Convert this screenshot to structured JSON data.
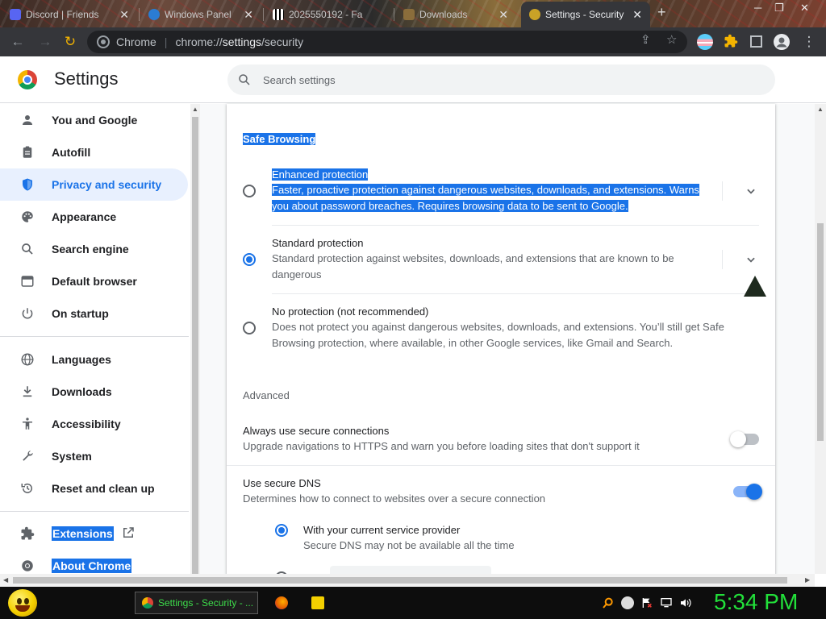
{
  "tabs": [
    {
      "title": "Discord | Friends",
      "close": "✕"
    },
    {
      "title": "Windows Panel",
      "close": "✕"
    },
    {
      "title": "2025550192 - Fa",
      "close": ""
    },
    {
      "title": "Downloads",
      "close": "✕"
    },
    {
      "title": "Settings - Security",
      "close": "✕",
      "active": true
    }
  ],
  "toolbar": {
    "app_label": "Chrome",
    "url_prefix": "chrome://",
    "url_host": "settings",
    "url_path": "/security"
  },
  "header": {
    "title": "Settings",
    "search_placeholder": "Search settings"
  },
  "sidebar": {
    "items": [
      {
        "label": "You and Google",
        "icon": "person-icon"
      },
      {
        "label": "Autofill",
        "icon": "clipboard-icon"
      },
      {
        "label": "Privacy and security",
        "icon": "shield-icon",
        "selected": true
      },
      {
        "label": "Appearance",
        "icon": "palette-icon"
      },
      {
        "label": "Search engine",
        "icon": "search-icon"
      },
      {
        "label": "Default browser",
        "icon": "browser-icon"
      },
      {
        "label": "On startup",
        "icon": "power-icon"
      },
      {
        "label": "Languages",
        "icon": "globe-icon"
      },
      {
        "label": "Downloads",
        "icon": "download-icon"
      },
      {
        "label": "Accessibility",
        "icon": "accessibility-icon"
      },
      {
        "label": "System",
        "icon": "wrench-icon"
      },
      {
        "label": "Reset and clean up",
        "icon": "history-icon"
      },
      {
        "label": "Extensions",
        "icon": "puzzle-icon"
      },
      {
        "label": "About Chrome",
        "icon": "chrome-icon"
      }
    ]
  },
  "safe_browsing": {
    "title": "Safe Browsing",
    "options": [
      {
        "label": "Enhanced protection",
        "desc_line1": "Faster, proactive protection against dangerous websites, downloads, and extensions. Warns",
        "desc_line2": "you about password breaches. Requires browsing data to be sent to Google.",
        "selected": false
      },
      {
        "label": "Standard protection",
        "desc_line1": "Standard protection against websites, downloads, and extensions that are known to be",
        "desc_line2": "dangerous",
        "selected": true
      },
      {
        "label": "No protection (not recommended)",
        "desc_line1": "Does not protect you against dangerous websites, downloads, and extensions. You’ll still get Safe",
        "desc_line2": "Browsing protection, where available, in other Google services, like Gmail and Search.",
        "selected": false
      }
    ]
  },
  "advanced": {
    "title": "Advanced",
    "secure_connections": {
      "label": "Always use secure connections",
      "desc": "Upgrade navigations to HTTPS and warn you before loading sites that don't support it",
      "enabled": false
    },
    "secure_dns": {
      "label": "Use secure DNS",
      "desc": "Determines how to connect to websites over a secure connection",
      "enabled": true,
      "provider_label": "With your current service provider",
      "provider_desc": "Secure DNS may not be available all the time"
    }
  },
  "taskbar": {
    "task_label": "Settings - Security - ...",
    "clock": "5:34 PM"
  },
  "colors": {
    "accent": "#1a73e8",
    "clock": "#22e03a"
  }
}
